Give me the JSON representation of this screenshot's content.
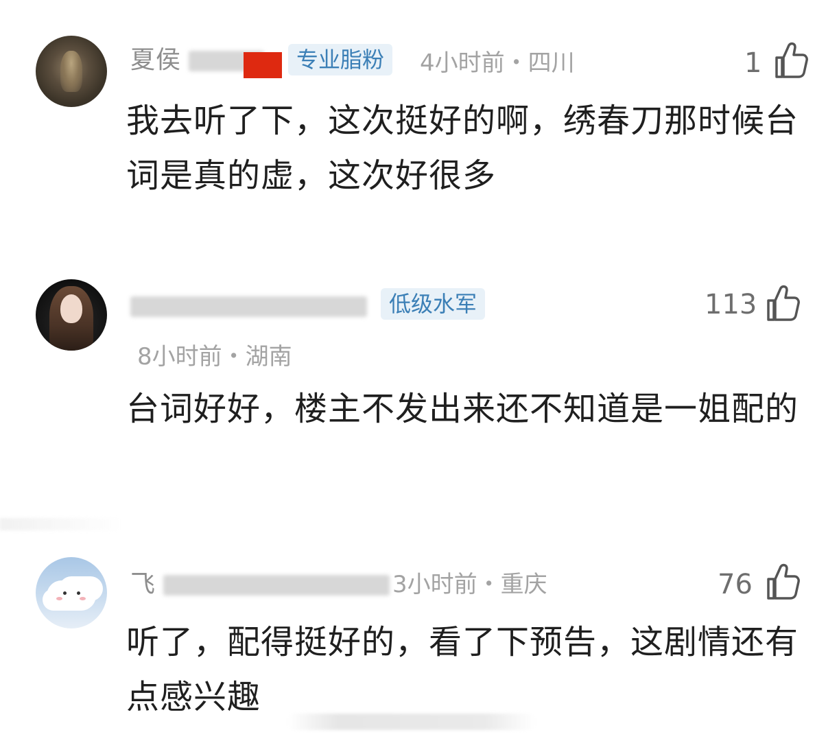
{
  "comments": [
    {
      "username": "夏侯",
      "tag": "专业脂粉",
      "time": "4小时前・四川",
      "likes": "1",
      "text": "我去听了下，这次挺好的啊，绣春刀那时候台词是真的虚，这次好很多"
    },
    {
      "username": "",
      "tag": "低级水军",
      "time": "8小时前・湖南",
      "likes": "113",
      "text": "台词好好，楼主不发出来还不知道是一姐配的"
    },
    {
      "username": "飞",
      "tag": "",
      "time": "3小时前・重庆",
      "likes": "76",
      "text": "听了，配得挺好的，看了下预告，这剧情还有点感兴趣"
    }
  ],
  "icons": {
    "like": "thumbs-up-icon"
  },
  "colors": {
    "tag_bg": "#e8f1f8",
    "tag_text": "#3b7fb6",
    "meta_gray": "#a3a3a3",
    "text": "#1f1f1f"
  }
}
